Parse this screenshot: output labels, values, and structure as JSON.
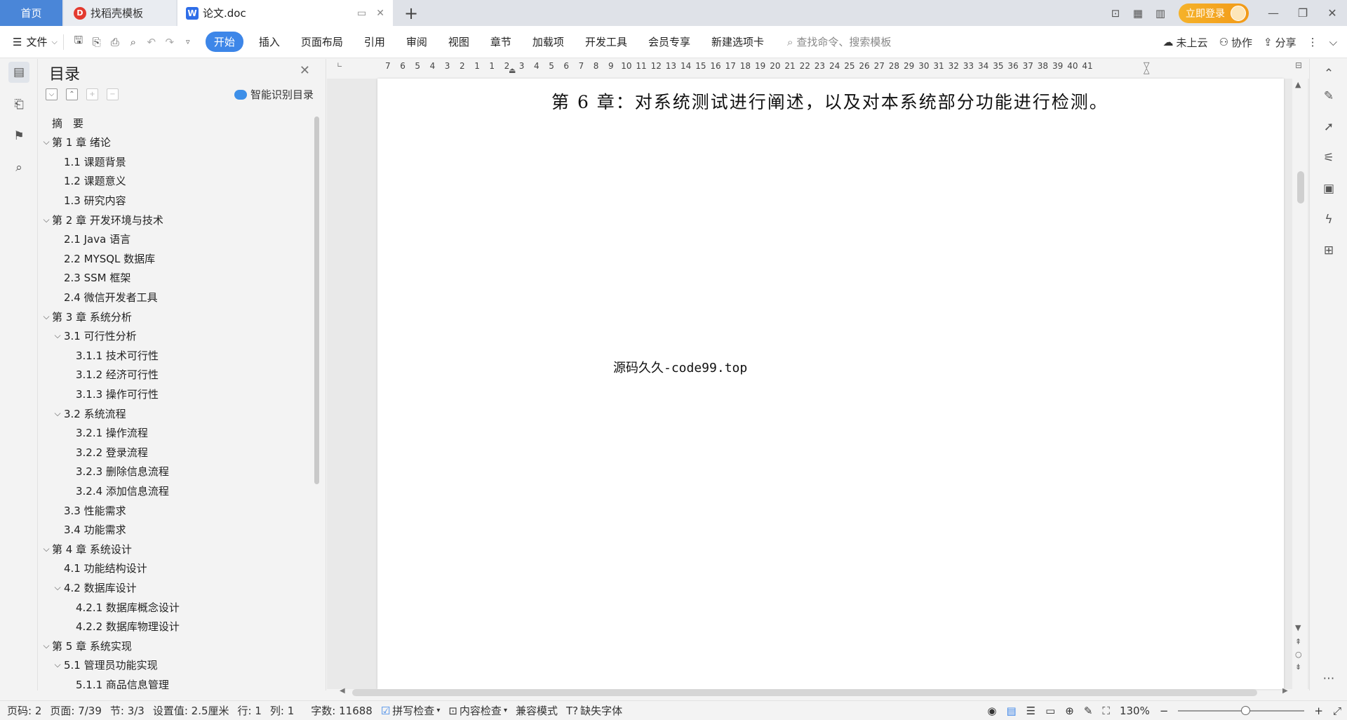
{
  "titlebar": {
    "tabs": [
      {
        "label": "首页"
      },
      {
        "label": "找稻壳模板",
        "icon": "docer-logo-icon"
      },
      {
        "label": "论文.doc",
        "icon": "wps-writer-icon"
      }
    ],
    "login_label": "立即登录"
  },
  "toolbar": {
    "file_label": "文件",
    "start_label": "开始",
    "menu_tabs": [
      "插入",
      "页面布局",
      "引用",
      "审阅",
      "视图",
      "章节",
      "加载项",
      "开发工具",
      "会员专享",
      "新建选项卡"
    ],
    "search_placeholder": "查找命令、搜索模板",
    "cloud_label": "未上云",
    "collab_label": "协作",
    "share_label": "分享"
  },
  "toc": {
    "title": "目录",
    "smart_label": "智能识别目录",
    "items": [
      {
        "label": "摘　要",
        "level": 1,
        "chevron": false
      },
      {
        "label": "第 1 章  绪论",
        "level": 1,
        "chevron": true
      },
      {
        "label": "1.1  课题背景",
        "level": 2,
        "chevron": false
      },
      {
        "label": "1.2  课题意义",
        "level": 2,
        "chevron": false
      },
      {
        "label": "1.3  研究内容",
        "level": 2,
        "chevron": false
      },
      {
        "label": "第 2 章  开发环境与技术",
        "level": 1,
        "chevron": true
      },
      {
        "label": "2.1 Java 语言",
        "level": 2,
        "chevron": false
      },
      {
        "label": "2.2 MYSQL 数据库",
        "level": 2,
        "chevron": false
      },
      {
        "label": "2.3 SSM 框架",
        "level": 2,
        "chevron": false
      },
      {
        "label": "2.4 微信开发者工具",
        "level": 2,
        "chevron": false
      },
      {
        "label": "第 3 章  系统分析",
        "level": 1,
        "chevron": true
      },
      {
        "label": "3.1  可行性分析",
        "level": 2,
        "chevron": true
      },
      {
        "label": "3.1.1  技术可行性",
        "level": 3,
        "chevron": false
      },
      {
        "label": "3.1.2  经济可行性",
        "level": 3,
        "chevron": false
      },
      {
        "label": "3.1.3  操作可行性",
        "level": 3,
        "chevron": false
      },
      {
        "label": "3.2  系统流程",
        "level": 2,
        "chevron": true
      },
      {
        "label": "3.2.1  操作流程",
        "level": 3,
        "chevron": false
      },
      {
        "label": "3.2.2  登录流程",
        "level": 3,
        "chevron": false
      },
      {
        "label": "3.2.3  删除信息流程",
        "level": 3,
        "chevron": false
      },
      {
        "label": "3.2.4  添加信息流程",
        "level": 3,
        "chevron": false
      },
      {
        "label": "3.3  性能需求",
        "level": 2,
        "chevron": false
      },
      {
        "label": "3.4  功能需求",
        "level": 2,
        "chevron": false
      },
      {
        "label": "第 4 章  系统设计",
        "level": 1,
        "chevron": true
      },
      {
        "label": "4.1  功能结构设计",
        "level": 2,
        "chevron": false
      },
      {
        "label": "4.2  数据库设计",
        "level": 2,
        "chevron": true
      },
      {
        "label": "4.2.1  数据库概念设计",
        "level": 3,
        "chevron": false
      },
      {
        "label": "4.2.2  数据库物理设计",
        "level": 3,
        "chevron": false
      },
      {
        "label": "第 5 章  系统实现",
        "level": 1,
        "chevron": true
      },
      {
        "label": "5.1  管理员功能实现",
        "level": 2,
        "chevron": true
      },
      {
        "label": "5.1.1  商品信息管理",
        "level": 3,
        "chevron": false
      }
    ]
  },
  "ruler": {
    "numbers": [
      "7",
      "6",
      "5",
      "4",
      "3",
      "2",
      "1",
      "1",
      "2",
      "3",
      "4",
      "5",
      "6",
      "7",
      "8",
      "9",
      "10",
      "11",
      "12",
      "13",
      "14",
      "15",
      "16",
      "17",
      "18",
      "19",
      "20",
      "21",
      "22",
      "23",
      "24",
      "25",
      "26",
      "27",
      "28",
      "29",
      "30",
      "31",
      "32",
      "33",
      "34",
      "35",
      "36",
      "37",
      "38",
      "39",
      "40",
      "41"
    ]
  },
  "document": {
    "chapter6_text": "第 6 章：对系统测试进行阐述，以及对本系统部分功能进行检测。",
    "watermark_text": "源码久久-code99.top"
  },
  "statusbar": {
    "page_code": "页码: 2",
    "page": "页面: 7/39",
    "section": "节: 3/3",
    "setting": "设置值: 2.5厘米",
    "row": "行: 1",
    "col": "列: 1",
    "word_count": "字数: 11688",
    "spell_check": "拼写检查",
    "content_check": "内容检查",
    "compat_mode": "兼容模式",
    "missing_font": "缺失字体",
    "zoom": "130%"
  }
}
